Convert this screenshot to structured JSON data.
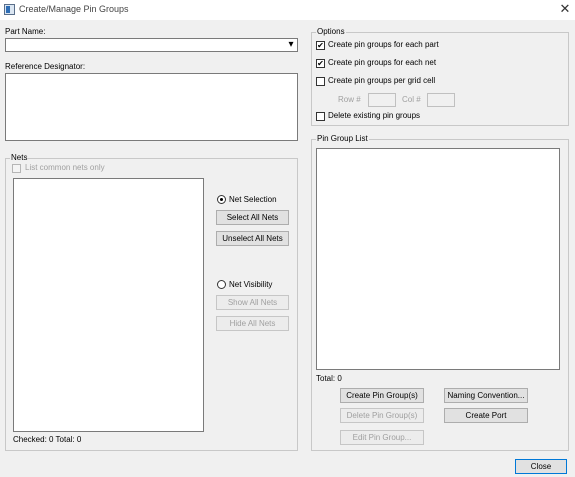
{
  "window": {
    "title": "Create/Manage Pin Groups",
    "close_glyph": "✕"
  },
  "part_name": {
    "label": "Part Name:",
    "value": "",
    "dropdown_glyph": "▾"
  },
  "ref_des": {
    "label": "Reference Designator:",
    "value": ""
  },
  "nets": {
    "legend": "Nets",
    "list_common_label": "List common nets only",
    "net_selection_label": "Net Selection",
    "select_all_label": "Select All Nets",
    "unselect_all_label": "Unselect All Nets",
    "net_visibility_label": "Net Visibility",
    "show_all_label": "Show All Nets",
    "hide_all_label": "Hide All Nets",
    "status": "Checked: 0 Total: 0"
  },
  "options": {
    "legend": "Options",
    "check_glyph": "✔",
    "each_part_label": "Create pin groups for each part",
    "each_net_label": "Create pin groups for each net",
    "grid_cell_label": "Create pin groups per grid cell",
    "row_label": "Row #",
    "col_label": "Col #",
    "delete_existing_label": "Delete existing pin groups"
  },
  "pin_group_list": {
    "legend": "Pin Group List",
    "total": "Total: 0",
    "create_label": "Create Pin Group(s)",
    "naming_label": "Naming Convention...",
    "delete_label": "Delete Pin Group(s)",
    "create_port_label": "Create Port",
    "edit_label": "Edit Pin Group..."
  },
  "footer": {
    "close_label": "Close"
  }
}
